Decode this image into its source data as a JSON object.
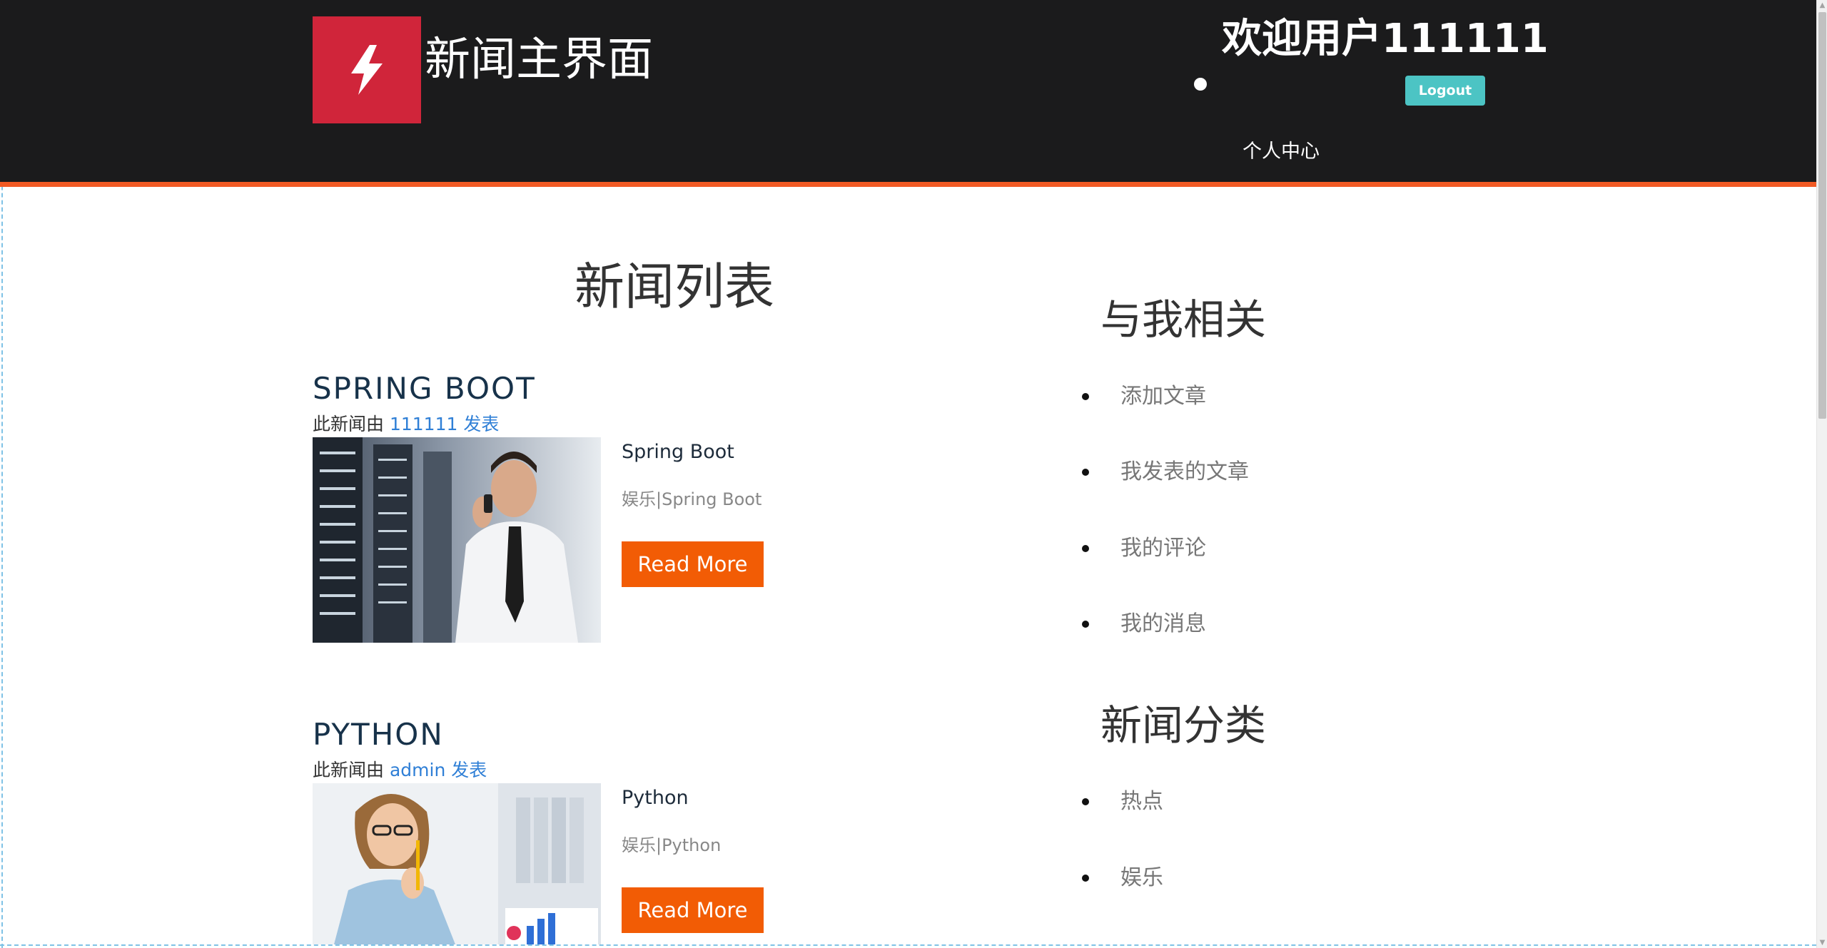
{
  "header": {
    "site_title": "新闻主界面",
    "welcome": "欢迎用户111111",
    "logout_label": "Logout",
    "personal_center": "个人中心",
    "accent_color": "#f15a24",
    "logo_color": "#d0253a",
    "logo_icon": "lightning-bolt-icon"
  },
  "news": {
    "heading": "新闻列表",
    "articles": [
      {
        "title": "SPRING BOOT",
        "byline_prefix": "此新闻由",
        "author": "111111",
        "byline_verb": "发表",
        "subtitle": "Spring Boot",
        "tags": "娱乐|Spring Boot",
        "read_more": "Read More",
        "image": "man-on-phone-in-server-room"
      },
      {
        "title": "PYTHON",
        "byline_prefix": "此新闻由",
        "author": "admin",
        "byline_verb": "发表",
        "subtitle": "Python",
        "tags": "娱乐|Python",
        "read_more": "Read More",
        "image": "woman-with-pencil-in-office"
      }
    ]
  },
  "sidebar": {
    "related_heading": "与我相关",
    "related_items": [
      "添加文章",
      "我发表的文章",
      "我的评论",
      "我的消息"
    ],
    "category_heading": "新闻分类",
    "category_items": [
      "热点",
      "娱乐"
    ]
  },
  "colors": {
    "read_more_bg": "#f25c05",
    "logout_bg": "#4cc4c4",
    "header_bg": "#1b1b1c",
    "link": "#2f7fd6"
  }
}
